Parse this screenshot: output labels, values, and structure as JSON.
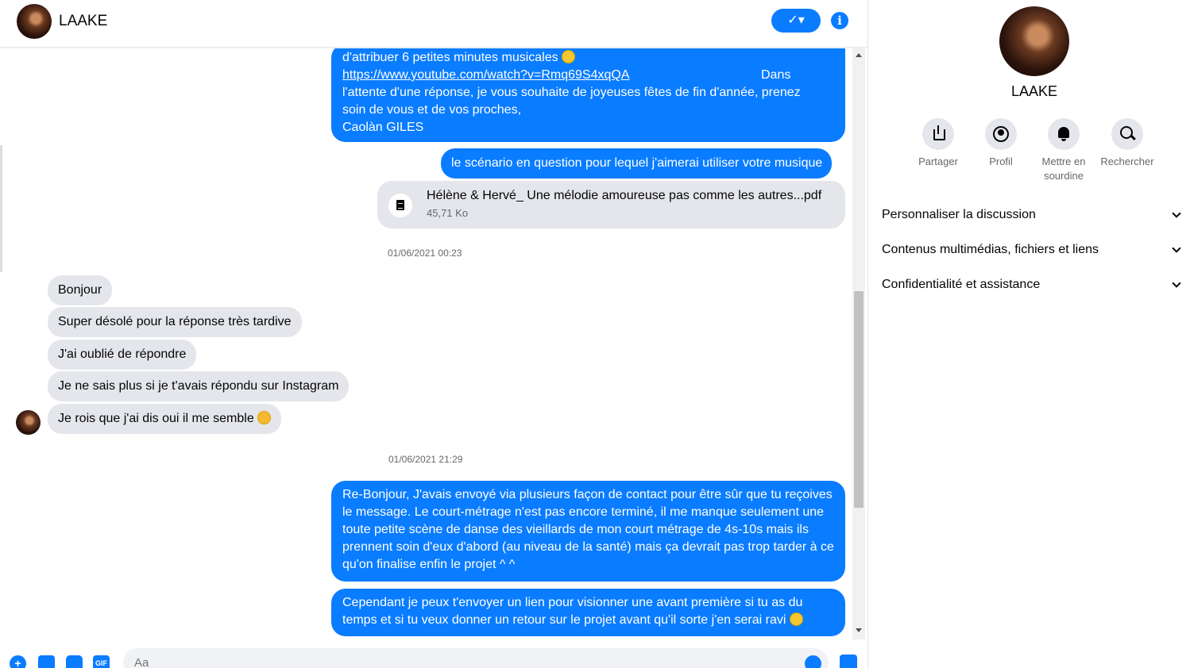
{
  "header": {
    "contact_name": "LAAKE",
    "check_label": "✓▾",
    "info_label": "i"
  },
  "messages": {
    "msg1_line1": "d'attribuer 6 petites minutes musicales",
    "msg1_link": "https://www.youtube.com/watch?v=Rmq69S4xqQA",
    "msg1_line2_tail": "Dans",
    "msg1_rest": "l'attente d'une réponse, je vous souhaite de joyeuses fêtes de fin d'année, prenez soin de vous et de vos proches,",
    "msg1_signature": "Caolàn GILES",
    "msg2": "le scénario en question pour lequel j'aimerai utiliser votre musique",
    "file_name": "Hélène & Hervé_ Une mélodie amoureuse pas comme les autres...pdf",
    "file_size": "45,71 Ko",
    "timestamp1": "01/06/2021 00:23",
    "in1": "Bonjour",
    "in2": "Super désolé pour la réponse très tardive",
    "in3": "J'ai oublié de répondre",
    "in4": "Je ne sais plus si je t'avais répondu sur Instagram",
    "in5": "Je rois que j'ai dis oui il me semble",
    "timestamp2": "01/06/2021 21:29",
    "msg3": "Re-Bonjour, J'avais envoyé via plusieurs façon de contact pour être sûr que tu reçoives le message. Le court-métrage n'est pas encore terminé, il me manque seulement une toute petite scène de danse des vieillards de mon court métrage de 4s-10s mais ils prennent soin d'eux d'abord (au niveau de la santé) mais ça devrait pas trop tarder à ce qu'on finalise enfin le projet ^ ^",
    "msg4": "Cependant je peux t'envoyer un lien pour visionner une avant première si tu as du temps et si tu veux donner un retour sur le projet avant qu'il sorte j'en serai ravi"
  },
  "composer": {
    "placeholder": "Aa",
    "gif_label": "GIF",
    "plus_label": "+"
  },
  "panel": {
    "name": "LAAKE",
    "actions": [
      {
        "label": "Partager"
      },
      {
        "label": "Profil"
      },
      {
        "label": "Mettre en sourdine"
      },
      {
        "label": "Rechercher"
      }
    ],
    "sections": [
      {
        "label": "Personnaliser la discussion"
      },
      {
        "label": "Contenus multimédias, fichiers et liens"
      },
      {
        "label": "Confidentialité et assistance"
      }
    ]
  },
  "colors": {
    "accent": "#0a7cff",
    "incoming_bubble": "#e4e6eb",
    "muted_text": "#65676b"
  }
}
